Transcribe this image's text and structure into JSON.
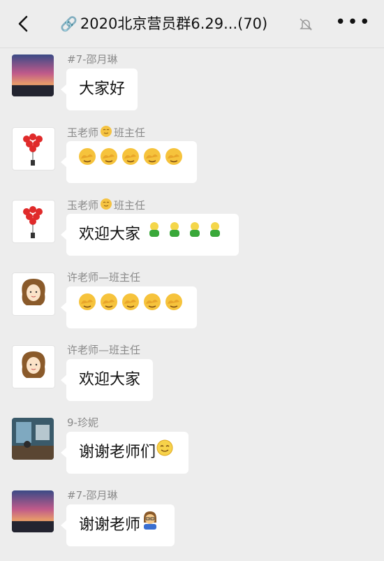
{
  "header": {
    "title": "2020北京营员群6.29...(70)",
    "link_icon": "link-icon",
    "mute_icon": "bell-muted-icon",
    "more_icon": "more-icon",
    "back_icon": "back-chevron-icon"
  },
  "messages": [
    {
      "sender": "#7-邵月琳",
      "text": "大家好",
      "emoji": [],
      "avatar": "sunset-avatar"
    },
    {
      "sender_prefix": "玉老师",
      "sender_suffix": "班主任",
      "text": "",
      "emoji": [
        "facepalm",
        "facepalm",
        "facepalm",
        "facepalm",
        "facepalm"
      ],
      "avatar": "balloons-avatar"
    },
    {
      "sender_prefix": "玉老师",
      "sender_suffix": "班主任",
      "text": "欢迎大家",
      "emoji": [
        "green-figure",
        "green-figure",
        "green-figure",
        "green-figure"
      ],
      "avatar": "balloons-avatar"
    },
    {
      "sender": "许老师—班主任",
      "text": "",
      "emoji": [
        "facepalm",
        "facepalm",
        "facepalm",
        "facepalm",
        "facepalm"
      ],
      "avatar": "girl-drawing-avatar"
    },
    {
      "sender": "许老师—班主任",
      "text": "欢迎大家",
      "emoji": [],
      "avatar": "girl-drawing-avatar"
    },
    {
      "sender": "9-珍妮",
      "text": "谢谢老师们",
      "emoji": [
        "smile"
      ],
      "avatar": "room-photo-avatar"
    },
    {
      "sender": "#7-邵月琳",
      "text": "谢谢老师",
      "emoji": [
        "teacher"
      ],
      "avatar": "sunset-avatar"
    }
  ]
}
